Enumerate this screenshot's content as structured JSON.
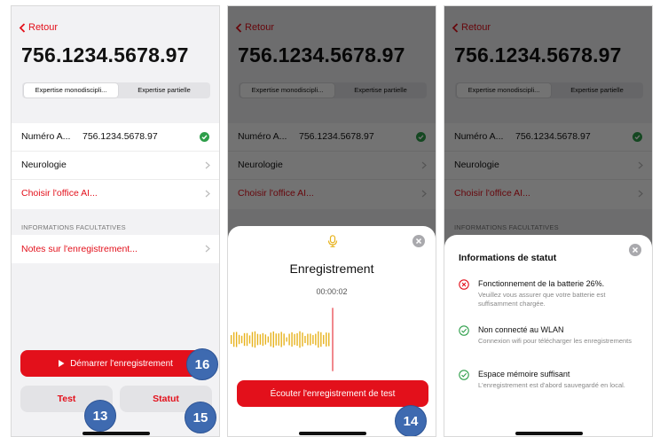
{
  "colors": {
    "accent": "#e3101b",
    "success": "#2e9e4a",
    "badge": "#3e6ab0"
  },
  "back_label": "Retour",
  "record_id": "756.1234.5678.97",
  "segments": [
    "Expertise monodiscipli...",
    "Expertise partielle"
  ],
  "rows": [
    {
      "label": "Numéro A...",
      "value": "756.1234.5678.97",
      "icon": "check-circle-icon"
    },
    {
      "label": "Neurologie",
      "icon": "chevron-right-icon"
    },
    {
      "label": "Choisir l'office AI...",
      "icon": "chevron-right-icon"
    }
  ],
  "section_optional": "INFORMATIONS FACULTATIVES",
  "notes_label": "Notes sur l'enregistrement...",
  "start_recording": "Démarrer l'enregistrement",
  "test_button": "Test",
  "status_button": "Statut",
  "badges": [
    "16",
    "13",
    "15",
    "14"
  ],
  "recording_sheet": {
    "icon": "microphone-icon",
    "title": "Enregistrement",
    "time": "00:00:02",
    "listen_button": "Écouter l'enregistrement de test"
  },
  "status_sheet": {
    "title": "Informations de statut",
    "items": [
      {
        "icon": "error-circle-icon",
        "title": "Fonctionnement de la batterie 26%.",
        "desc": "Veuillez vous assurer que votre batterie est suffisamment chargée."
      },
      {
        "icon": "check-circle-icon",
        "title": "Non connecté au WLAN",
        "desc": "Connexion wifi pour télécharger les enregistrements"
      },
      {
        "icon": "check-circle-icon",
        "title": "Espace mémoire suffisant",
        "desc": "L'enregistrement est d'abord sauvegardé en local."
      }
    ]
  }
}
